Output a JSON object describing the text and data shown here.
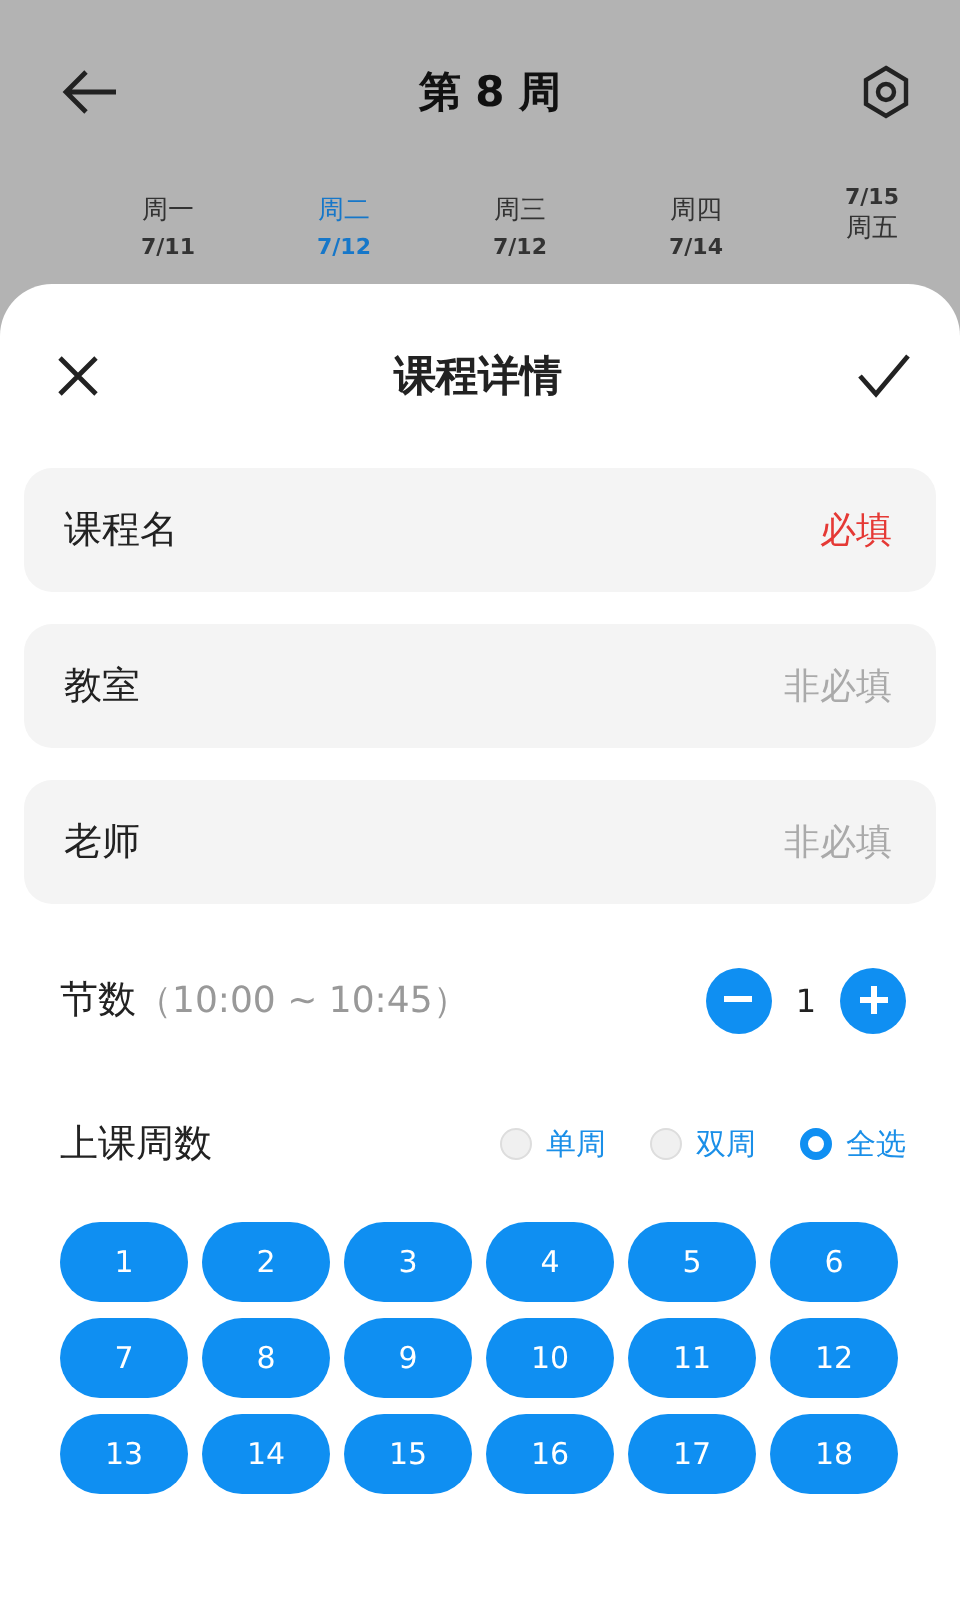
{
  "header": {
    "title": "第 8 周"
  },
  "days": [
    {
      "label": "周一",
      "date": "7/11",
      "selected": false,
      "kind": "normal"
    },
    {
      "label": "周二",
      "date": "7/12",
      "selected": true,
      "kind": "normal"
    },
    {
      "label": "周三",
      "date": "7/12",
      "selected": false,
      "kind": "normal"
    },
    {
      "label": "周四",
      "date": "7/14",
      "selected": false,
      "kind": "normal"
    },
    {
      "label": "周五",
      "date": "7/15",
      "selected": false,
      "kind": "overlap"
    }
  ],
  "sheet": {
    "title": "课程详情"
  },
  "fields": [
    {
      "label": "课程名",
      "placeholder": "必填",
      "required": true
    },
    {
      "label": "教室",
      "placeholder": "非必填",
      "required": false
    },
    {
      "label": "老师",
      "placeholder": "非必填",
      "required": false
    }
  ],
  "sessions": {
    "label": "节数",
    "time": "（10:00 ~ 10:45）",
    "value": "1"
  },
  "weeks": {
    "label": "上课周数",
    "options": [
      {
        "label": "单周",
        "selected": false
      },
      {
        "label": "双周",
        "selected": false
      },
      {
        "label": "全选",
        "selected": true
      }
    ],
    "numbers": [
      {
        "label": "1",
        "selected": true
      },
      {
        "label": "2",
        "selected": true
      },
      {
        "label": "3",
        "selected": true
      },
      {
        "label": "4",
        "selected": true
      },
      {
        "label": "5",
        "selected": true
      },
      {
        "label": "6",
        "selected": true
      },
      {
        "label": "7",
        "selected": true
      },
      {
        "label": "8",
        "selected": true
      },
      {
        "label": "9",
        "selected": true
      },
      {
        "label": "10",
        "selected": true
      },
      {
        "label": "11",
        "selected": true
      },
      {
        "label": "12",
        "selected": true
      },
      {
        "label": "13",
        "selected": true
      },
      {
        "label": "14",
        "selected": true
      },
      {
        "label": "15",
        "selected": true
      },
      {
        "label": "16",
        "selected": true
      },
      {
        "label": "17",
        "selected": true
      },
      {
        "label": "18",
        "selected": true
      }
    ]
  }
}
